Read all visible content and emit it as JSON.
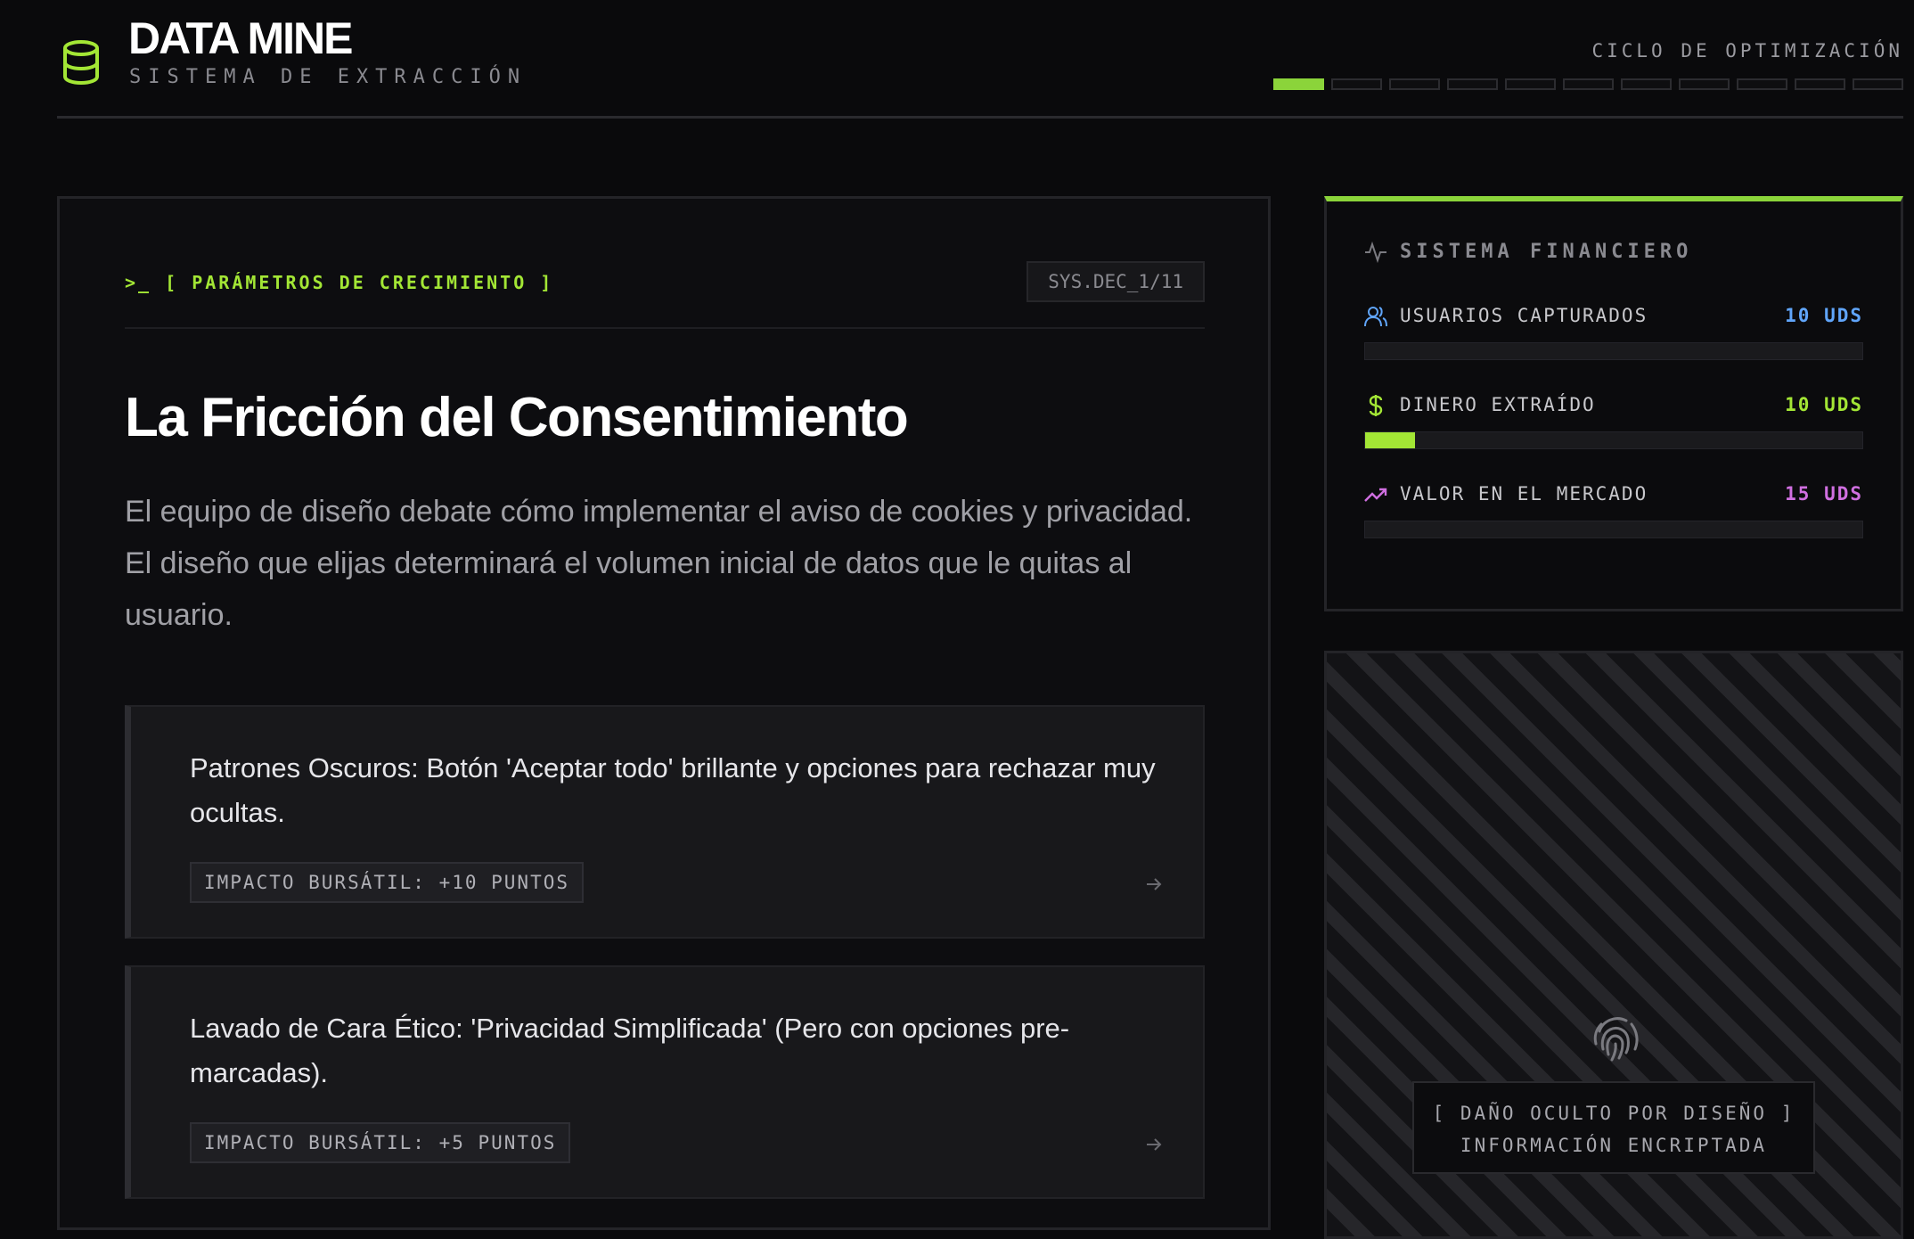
{
  "header": {
    "logo_icon": "database-icon",
    "title": "DATA MINE",
    "subtitle": "SISTEMA DE EXTRACCIÓN",
    "cycle_label": "CICLO DE OPTIMIZACIÓN",
    "cycle_total": 11,
    "cycle_current": 1,
    "accent_color": "#8bd43a"
  },
  "main": {
    "section_label": ">_ [ PARÁMETROS DE CRECIMIENTO ]",
    "sys_badge": "SYS.DEC_1/11",
    "title": "La Fricción del Consentimiento",
    "description": "El equipo de diseño debate cómo implementar el aviso de cookies y privacidad. El diseño que elijas determinará el volumen inicial de datos que le quitas al usuario.",
    "options": [
      {
        "text": "Patrones Oscuros: Botón 'Aceptar todo' brillante y opciones para rechazar muy ocultas.",
        "impact": "IMPACTO BURSÁTIL: +10 PUNTOS",
        "icon": "arrow-right-icon"
      },
      {
        "text": "Lavado de Cara Ético: 'Privacidad Simplificada' (Pero con opciones pre-marcadas).",
        "impact": "IMPACTO BURSÁTIL: +5 PUNTOS",
        "icon": "arrow-right-icon"
      }
    ]
  },
  "finance": {
    "title": "SISTEMA FINANCIERO",
    "title_icon": "activity-icon",
    "metrics": [
      {
        "label": "USUARIOS CAPTURADOS",
        "value": "10 UDS",
        "icon": "users-icon",
        "color": "#60a5fa",
        "fill": 0
      },
      {
        "label": "DINERO EXTRAÍDO",
        "value": "10 UDS",
        "icon": "dollar-icon",
        "color": "#a3e635",
        "fill": 0.1
      },
      {
        "label": "VALOR EN EL MERCADO",
        "value": "15 UDS",
        "icon": "trending-up-icon",
        "color": "#d06fe0",
        "fill": 0
      }
    ]
  },
  "encrypted": {
    "icon": "fingerprint-icon",
    "line1": "[ DAÑO OCULTO POR DISEÑO ]",
    "line2": "INFORMACIÓN ENCRIPTADA"
  }
}
